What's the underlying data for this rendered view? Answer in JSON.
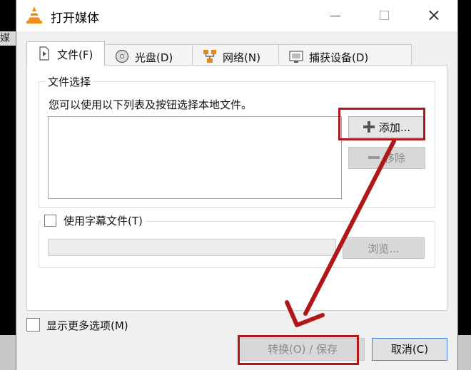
{
  "window": {
    "title": "打开媒体",
    "controls": {
      "minimize": "minimize",
      "maximize": "maximize",
      "close": "close"
    }
  },
  "background": {
    "left_text": "媒体"
  },
  "tabs": [
    {
      "label": "文件(F)",
      "icon": "file-play-icon",
      "active": true
    },
    {
      "label": "光盘(D)",
      "icon": "disc-icon",
      "active": false
    },
    {
      "label": "网络(N)",
      "icon": "network-icon",
      "active": false
    },
    {
      "label": "捕获设备(D)",
      "icon": "capture-device-icon",
      "active": false
    }
  ],
  "file_selection": {
    "title": "文件选择",
    "description": "您可以使用以下列表及按钮选择本地文件。",
    "add_button": "添加...",
    "remove_button": "移除"
  },
  "subtitle": {
    "checkbox_label": "使用字幕文件(T)",
    "checked": false,
    "path_value": "",
    "browse_button": "浏览..."
  },
  "footer": {
    "more_options": "显示更多选项(M)",
    "more_options_checked": false,
    "convert_button": "转换(O) / 保存",
    "cancel_button": "取消(C)"
  },
  "annotations": {
    "highlight_color": "#b01818"
  }
}
